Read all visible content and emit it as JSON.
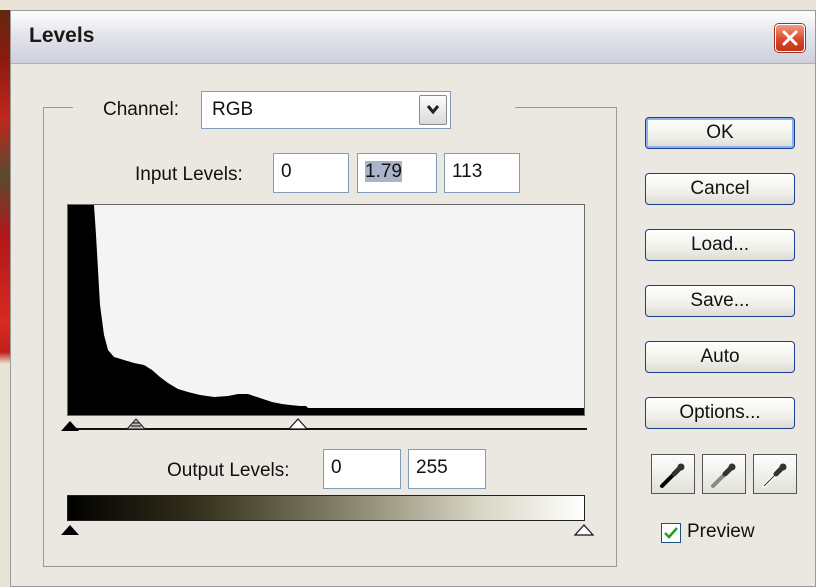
{
  "window": {
    "title": "Levels"
  },
  "channel": {
    "label": "Channel:",
    "value": "RGB"
  },
  "input_levels": {
    "label": "Input Levels:",
    "black": "0",
    "gamma": "1.79",
    "white": "113"
  },
  "output_levels": {
    "label": "Output Levels:",
    "black": "0",
    "white": "255"
  },
  "buttons": {
    "ok": "OK",
    "cancel": "Cancel",
    "load": "Load...",
    "save": "Save...",
    "auto": "Auto",
    "options": "Options..."
  },
  "eyedroppers": [
    "black-point-eyedropper-icon",
    "gray-point-eyedropper-icon",
    "white-point-eyedropper-icon"
  ],
  "preview": {
    "label": "Preview",
    "checked": true
  },
  "icons": {
    "close": "close-icon",
    "dropdown": "chevron-down-icon"
  },
  "colors": {
    "close_button": "#d84a2a",
    "button_border": "#1c3f94",
    "histogram_fill": "#000000"
  }
}
